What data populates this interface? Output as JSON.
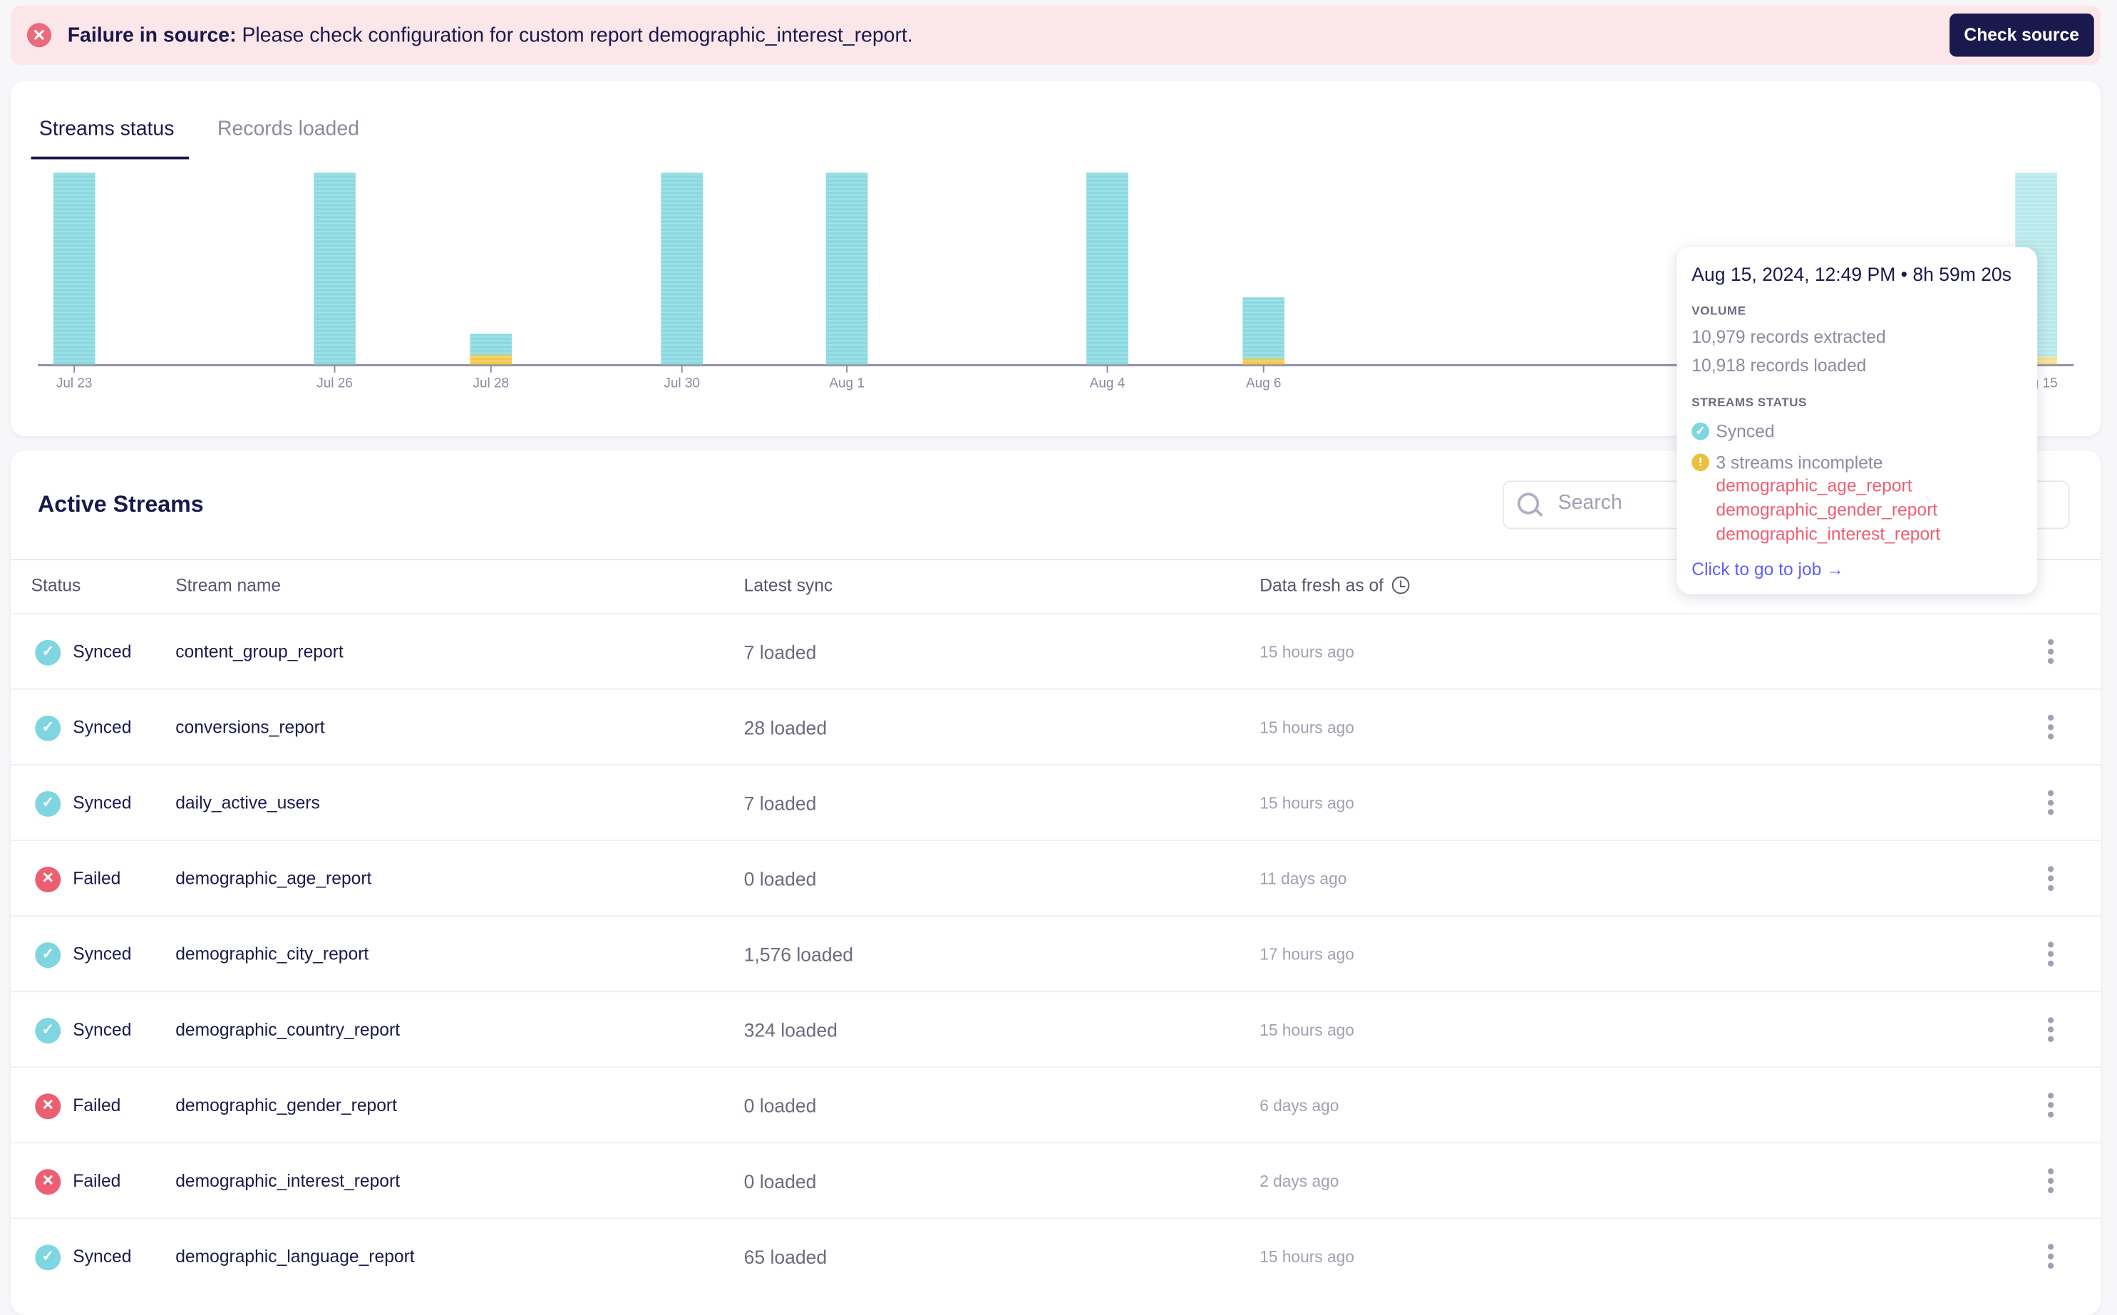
{
  "banner": {
    "title": "Failure in source:",
    "message": "Please check configuration for custom report demographic_interest_report.",
    "button": "Check source"
  },
  "tabs": [
    {
      "label": "Streams status",
      "active": true
    },
    {
      "label": "Records loaded",
      "active": false
    }
  ],
  "colors": {
    "synced": "#8bd9e0",
    "incomplete": "#f0c94d",
    "failed": "#ec5f73",
    "accent": "#1a194d",
    "link": "#615eff"
  },
  "chart_data": {
    "type": "bar",
    "stacked": true,
    "title": "Streams status",
    "x_unit": "days since Jul 23",
    "categories": [
      "Jul 23",
      "Jul 26",
      "Jul 28",
      "Jul 30",
      "Aug 1",
      "Aug 4",
      "Aug 6",
      "Aug 15"
    ],
    "x": [
      0,
      3.0,
      4.8,
      7.0,
      8.9,
      11.9,
      13.7,
      22.6
    ],
    "xlim": [
      -0.5,
      23.0
    ],
    "series": [
      {
        "name": "Synced",
        "values": [
          1,
          1,
          0.11,
          1,
          1,
          1,
          0.32,
          0.96
        ]
      },
      {
        "name": "Incomplete",
        "values": [
          0,
          0,
          0.05,
          0,
          0,
          0,
          0.03,
          0.04
        ]
      }
    ],
    "ylim": [
      0,
      1
    ],
    "grid": false,
    "highlighted": "Aug 15"
  },
  "tooltip": {
    "title": "Aug 15, 2024, 12:49 PM • 8h 59m 20s",
    "volume_label": "VOLUME",
    "extracted": "10,979 records extracted",
    "loaded": "10,918 records loaded",
    "status_label": "STREAMS STATUS",
    "synced": "Synced",
    "incomplete": "3 streams incomplete",
    "incomplete_streams": [
      "demographic_age_report",
      "demographic_gender_report",
      "demographic_interest_report"
    ],
    "link": "Click to go to job →"
  },
  "streams": {
    "title": "Active Streams",
    "search_placeholder": "Search",
    "columns": {
      "status": "Status",
      "name": "Stream name",
      "latest_sync": "Latest sync",
      "fresh": "Data fresh as of"
    },
    "rows": [
      {
        "status": "Synced",
        "name": "content_group_report",
        "sync": "7 loaded",
        "fresh": "15 hours ago"
      },
      {
        "status": "Synced",
        "name": "conversions_report",
        "sync": "28 loaded",
        "fresh": "15 hours ago"
      },
      {
        "status": "Synced",
        "name": "daily_active_users",
        "sync": "7 loaded",
        "fresh": "15 hours ago"
      },
      {
        "status": "Failed",
        "name": "demographic_age_report",
        "sync": "0 loaded",
        "fresh": "11 days ago"
      },
      {
        "status": "Synced",
        "name": "demographic_city_report",
        "sync": "1,576 loaded",
        "fresh": "17 hours ago"
      },
      {
        "status": "Synced",
        "name": "demographic_country_report",
        "sync": "324 loaded",
        "fresh": "15 hours ago"
      },
      {
        "status": "Failed",
        "name": "demographic_gender_report",
        "sync": "0 loaded",
        "fresh": "6 days ago"
      },
      {
        "status": "Failed",
        "name": "demographic_interest_report",
        "sync": "0 loaded",
        "fresh": "2 days ago"
      },
      {
        "status": "Synced",
        "name": "demographic_language_report",
        "sync": "65 loaded",
        "fresh": "15 hours ago"
      }
    ]
  }
}
